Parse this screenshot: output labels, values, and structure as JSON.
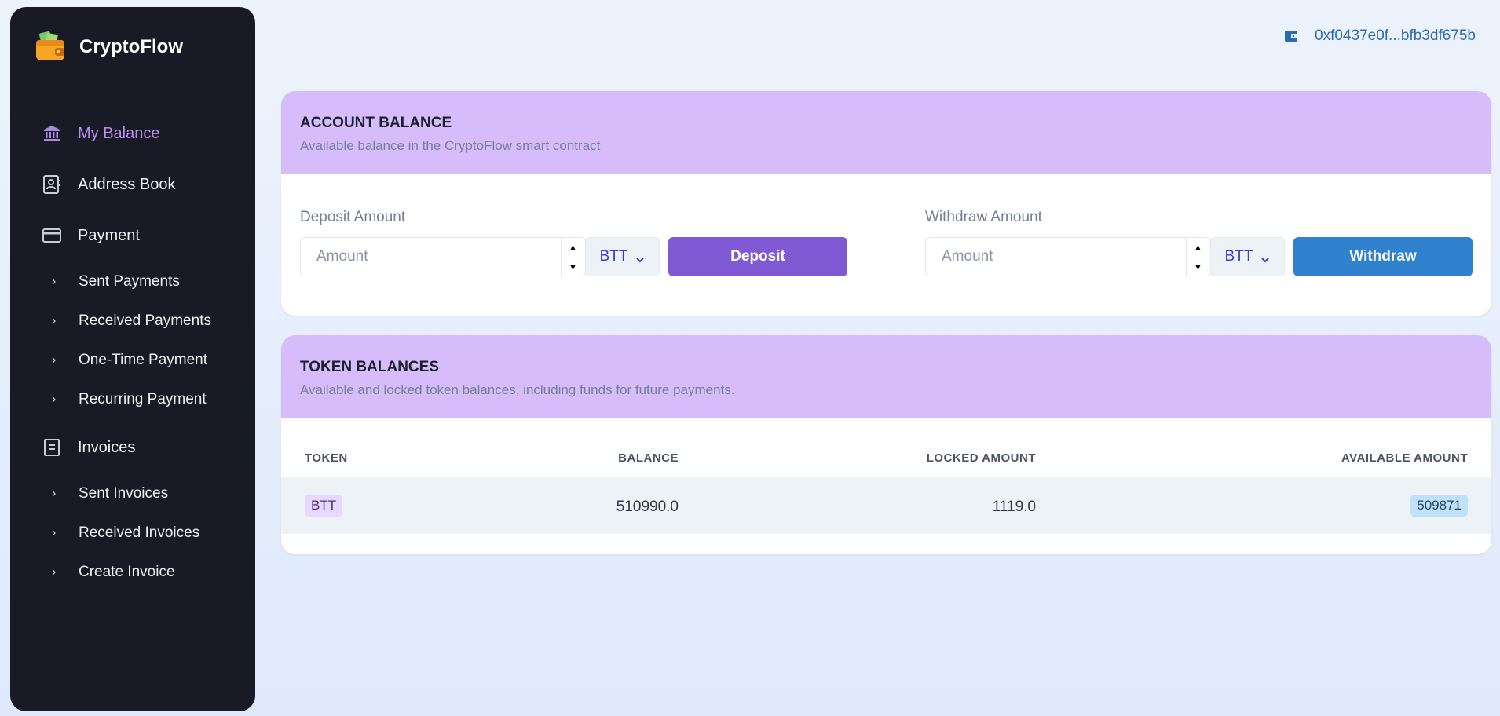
{
  "brand": {
    "name": "CryptoFlow",
    "logo_icon": "wallet-icon"
  },
  "sidebar": {
    "items": [
      {
        "label": "My Balance",
        "icon": "bank-icon",
        "active": true
      },
      {
        "label": "Address Book",
        "icon": "contacts-icon"
      },
      {
        "label": "Payment",
        "icon": "card-icon"
      },
      {
        "label": "Sent Payments"
      },
      {
        "label": "Received Payments"
      },
      {
        "label": "One-Time Payment"
      },
      {
        "label": "Recurring Payment"
      },
      {
        "label": "Invoices",
        "icon": "invoice-icon"
      },
      {
        "label": "Sent Invoices"
      },
      {
        "label": "Received Invoices"
      },
      {
        "label": "Create Invoice"
      }
    ]
  },
  "header": {
    "wallet_address": "0xf0437e0f...bfb3df675b"
  },
  "account_balance": {
    "title": "ACCOUNT BALANCE",
    "subtitle": "Available balance in the CryptoFlow smart contract",
    "deposit": {
      "label": "Deposit Amount",
      "placeholder": "Amount",
      "value": "",
      "token": "BTT",
      "button": "Deposit"
    },
    "withdraw": {
      "label": "Withdraw Amount",
      "placeholder": "Amount",
      "value": "",
      "token": "BTT",
      "button": "Withdraw"
    }
  },
  "token_balances": {
    "title": "TOKEN BALANCES",
    "subtitle": "Available and locked token balances, including funds for future payments.",
    "columns": [
      "TOKEN",
      "BALANCE",
      "LOCKED AMOUNT",
      "AVAILABLE AMOUNT"
    ],
    "rows": [
      {
        "token": "BTT",
        "balance": "510990.0",
        "locked": "1119.0",
        "available": "509871"
      }
    ]
  },
  "colors": {
    "sidebar_bg": "#181b25",
    "active_nav": "#b78ef2",
    "card_header": "#d6bcfa",
    "deposit_button": "#805ad5",
    "withdraw_button": "#3182ce",
    "wallet_text": "#2b6cb0"
  }
}
